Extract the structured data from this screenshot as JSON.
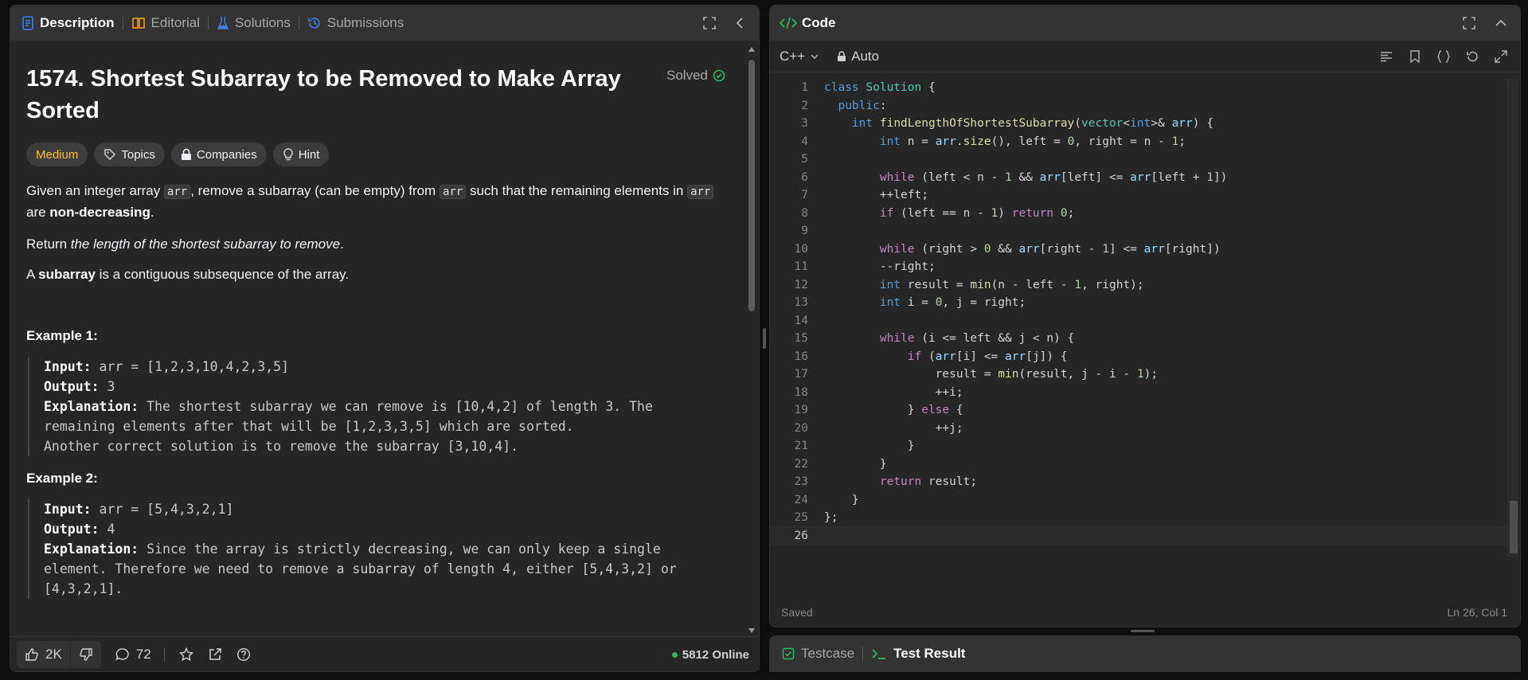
{
  "left": {
    "tabs": [
      {
        "label": "Description",
        "icon": "document-icon",
        "color": "#3b82f6"
      },
      {
        "label": "Editorial",
        "icon": "book-icon",
        "color": "#ffa116"
      },
      {
        "label": "Solutions",
        "icon": "flask-icon",
        "color": "#3b82f6"
      },
      {
        "label": "Submissions",
        "icon": "history-icon",
        "color": "#3b82f6"
      }
    ],
    "problem": {
      "title": "1574. Shortest Subarray to be Removed to Make Array Sorted",
      "status": "Solved",
      "difficulty": "Medium",
      "chips": [
        "Topics",
        "Companies",
        "Hint"
      ],
      "p1_a": "Given an integer array ",
      "p1_code1": "arr",
      "p1_b": ", remove a subarray (can be empty) from ",
      "p1_code2": "arr",
      "p1_c": " such that the remaining elements in ",
      "p1_code3": "arr",
      "p1_d": " are ",
      "p1_bold": "non-decreasing",
      "p1_e": ".",
      "p2_a": "Return ",
      "p2_italic": "the length of the shortest subarray to remove",
      "p2_b": ".",
      "p3_a": "A ",
      "p3_bold": "subarray",
      "p3_b": " is a contiguous subsequence of the array."
    },
    "examples": [
      {
        "title": "Example 1:",
        "input_label": "Input:",
        "input": " arr = [1,2,3,10,4,2,3,5]",
        "output_label": "Output:",
        "output": " 3",
        "explanation_label": "Explanation:",
        "explanation": " The shortest subarray we can remove is [10,4,2] of length 3. The remaining elements after that will be [1,2,3,3,5] which are sorted.\nAnother correct solution is to remove the subarray [3,10,4]."
      },
      {
        "title": "Example 2:",
        "input_label": "Input:",
        "input": " arr = [5,4,3,2,1]",
        "output_label": "Output:",
        "output": " 4",
        "explanation_label": "Explanation:",
        "explanation": " Since the array is strictly decreasing, we can only keep a single element. Therefore we need to remove a subarray of length 4, either [5,4,3,2] or [4,3,2,1]."
      }
    ],
    "bottom": {
      "likes": "2K",
      "comments": "72",
      "online": "5812 Online"
    }
  },
  "code": {
    "title": "Code",
    "language": "C++",
    "mode": "Auto",
    "status": "Saved",
    "cursor": "Ln 26, Col 1",
    "lines": [
      "class Solution {",
      "  public:",
      "    int findLengthOfShortestSubarray(vector<int>& arr) {",
      "        int n = arr.size(), left = 0, right = n - 1;",
      "",
      "        while (left < n - 1 && arr[left] <= arr[left + 1])",
      "        ++left;",
      "        if (left == n - 1) return 0;",
      "",
      "        while (right > 0 && arr[right - 1] <= arr[right])",
      "        --right;",
      "        int result = min(n - left - 1, right);",
      "        int i = 0, j = right;",
      "",
      "        while (i <= left && j < n) {",
      "            if (arr[i] <= arr[j]) {",
      "                result = min(result, j - i - 1);",
      "                ++i;",
      "            } else {",
      "                ++j;",
      "            }",
      "        }",
      "        return result;",
      "    }",
      "};",
      ""
    ]
  },
  "result": {
    "tabs": [
      "Testcase",
      "Test Result"
    ]
  }
}
